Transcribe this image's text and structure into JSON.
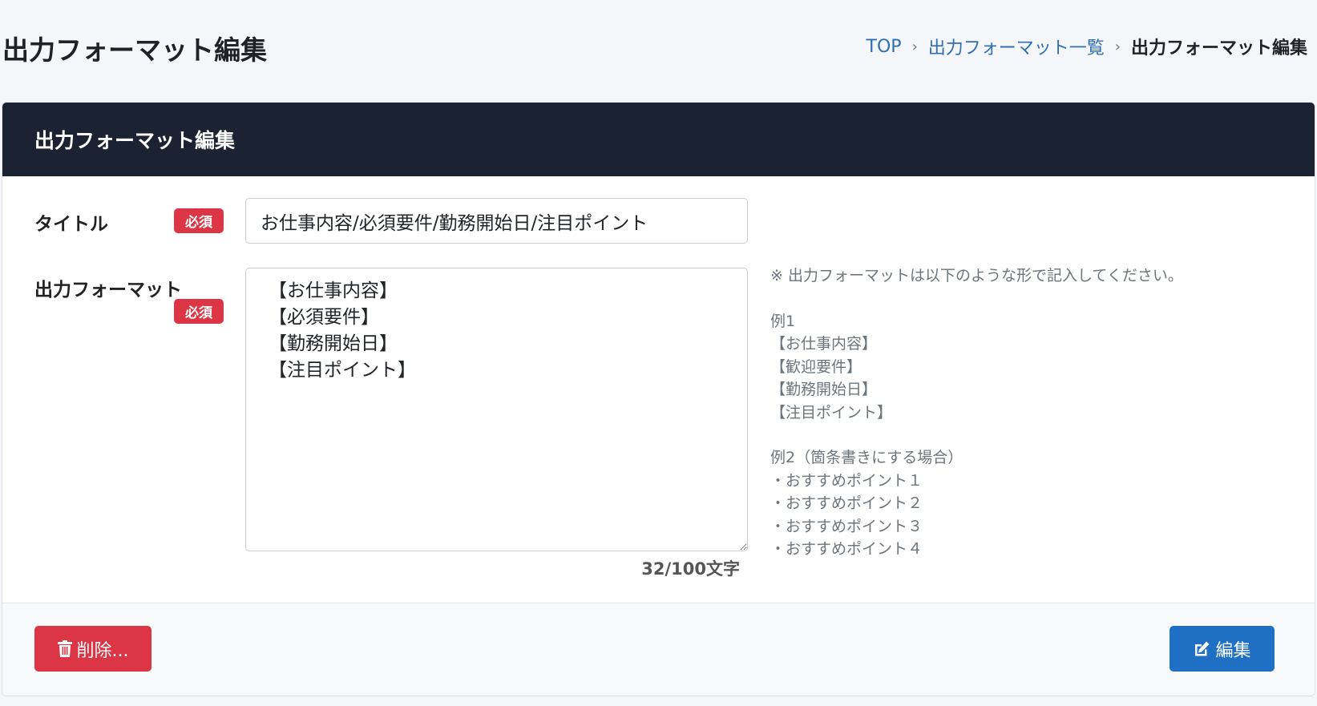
{
  "page": {
    "title": "出力フォーマット編集"
  },
  "breadcrumb": {
    "items": [
      "TOP",
      "出力フォーマット一覧"
    ],
    "separator": "›",
    "current": "出力フォーマット編集"
  },
  "card": {
    "header_title": "出力フォーマット編集"
  },
  "form": {
    "title_label": "タイトル",
    "format_label": "出力フォーマット",
    "required_badge": "必須",
    "title_value": "お仕事内容/必須要件/勤務開始日/注目ポイント",
    "format_value": "【お仕事内容】\n【必須要件】\n【勤務開始日】\n【注目ポイント】",
    "char_count": "32/100文字"
  },
  "hint": {
    "note": "※ 出力フォーマットは以下のような形で記入してください。",
    "example1_label": "例1",
    "example1_lines": [
      "【お仕事内容】",
      "【歓迎要件】",
      "【勤務開始日】",
      "【注目ポイント】"
    ],
    "example2_label": "例2（箇条書きにする場合）",
    "example2_lines": [
      "・おすすめポイント１",
      "・おすすめポイント２",
      "・おすすめポイント３",
      "・おすすめポイント４"
    ]
  },
  "footer": {
    "delete_label": "削除...",
    "edit_label": "編集"
  },
  "icons": {
    "delete": "trash-icon",
    "edit": "edit-icon"
  },
  "colors": {
    "header_bg": "#1b2333",
    "danger": "#dc3545",
    "primary": "#1f6fc5",
    "link": "#2f6fb3"
  }
}
